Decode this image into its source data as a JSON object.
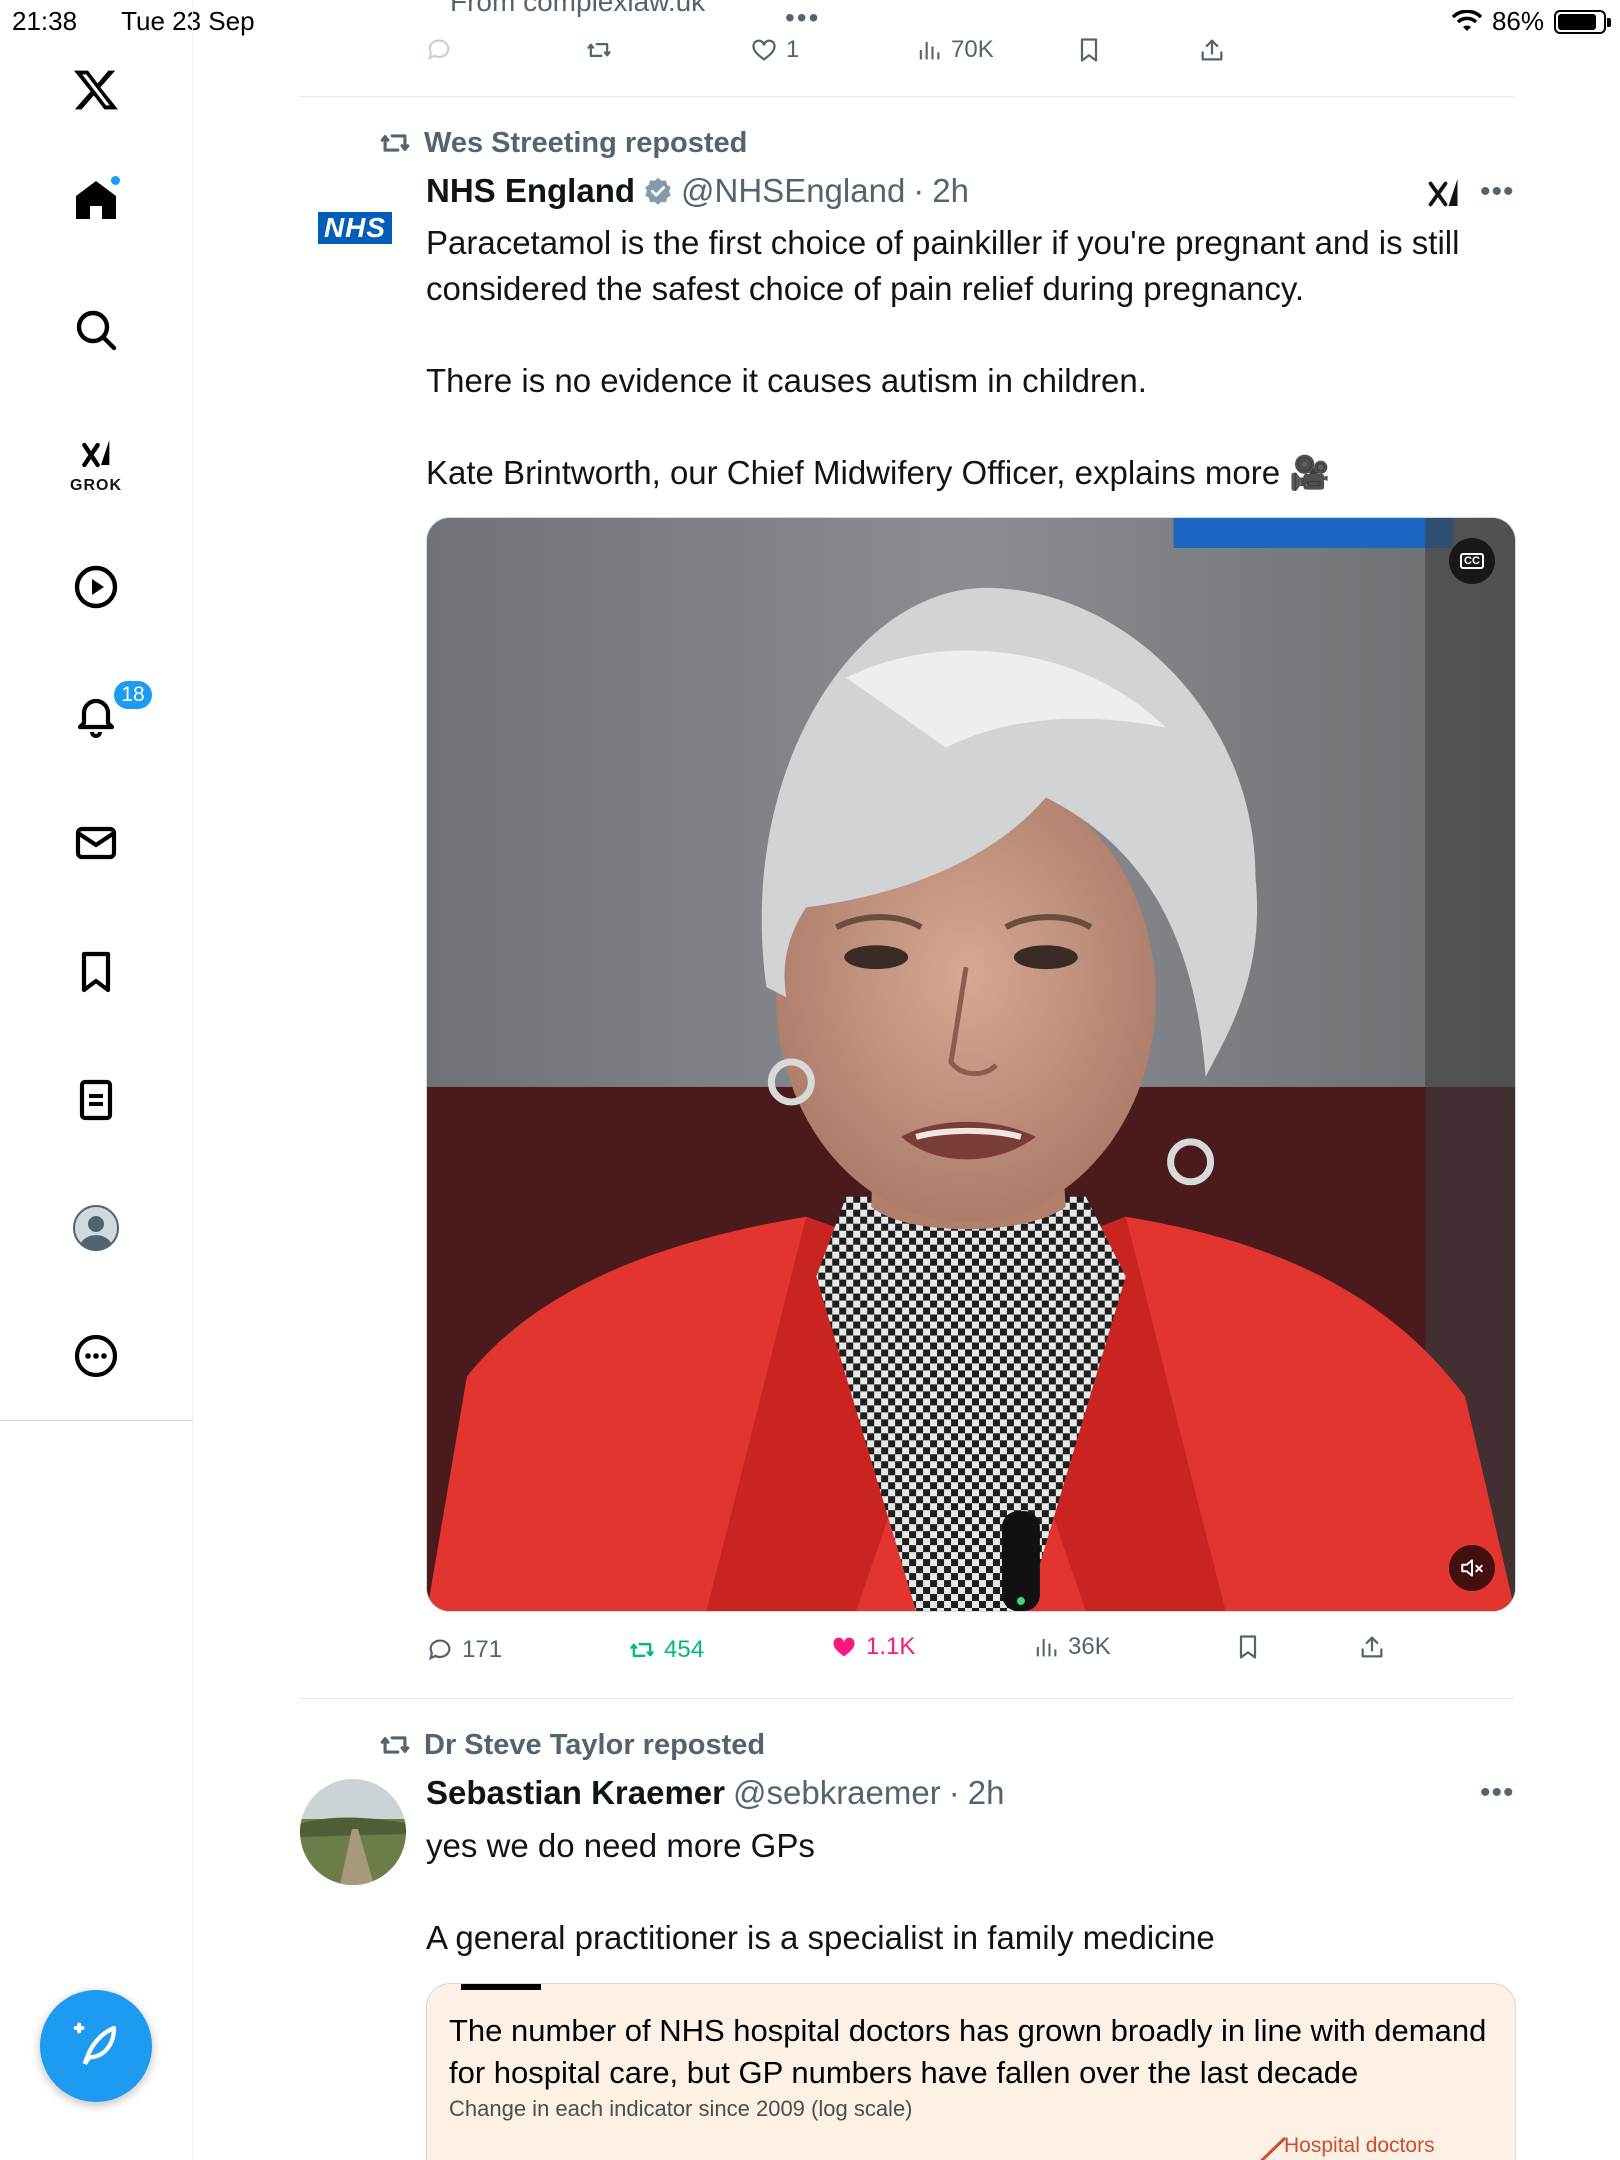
{
  "status_bar": {
    "time": "21:38",
    "date": "Tue 23 Sep",
    "battery": "86%"
  },
  "sidebar": {
    "grok_label": "GROK",
    "notifications_badge": "18"
  },
  "previous_tweet": {
    "link_text": "From complexlaw.uk",
    "likes": "1",
    "views": "70K"
  },
  "tweet1": {
    "reposted_by": "Wes Streeting reposted",
    "avatar_text": "NHS",
    "name": "NHS England",
    "handle": "@NHSEngland",
    "sep": "·",
    "time": "2h",
    "text_p1": "Paracetamol is the first choice of painkiller if you're pregnant and is still considered the safest choice of pain relief during pregnancy.",
    "text_p2": "There is no evidence it causes autism in children.",
    "text_p3": "Kate Brintworth, our Chief Midwifery Officer, explains more 🎥",
    "video_cc": "CC",
    "replies": "171",
    "reposts": "454",
    "likes": "1.1K",
    "views": "36K"
  },
  "tweet2": {
    "reposted_by": "Dr Steve Taylor reposted",
    "name": "Sebastian Kraemer",
    "handle": "@sebkraemer",
    "sep": "·",
    "time": "2h",
    "text_p1": "yes we do need more GPs",
    "text_p2": "A general practitioner is a specialist in family medicine",
    "card": {
      "headline": "The number of NHS hospital doctors has grown broadly in line with demand for hospital care, but GP numbers have fallen over the last decade",
      "subtitle": "Change in each indicator since 2009 (log scale)",
      "series_label": "Hospital doctors"
    }
  },
  "colors": {
    "accent": "#1d9bf0",
    "repost_green": "#00ba7c",
    "like_pink": "#f91880",
    "nhs_blue": "#005eb8"
  }
}
